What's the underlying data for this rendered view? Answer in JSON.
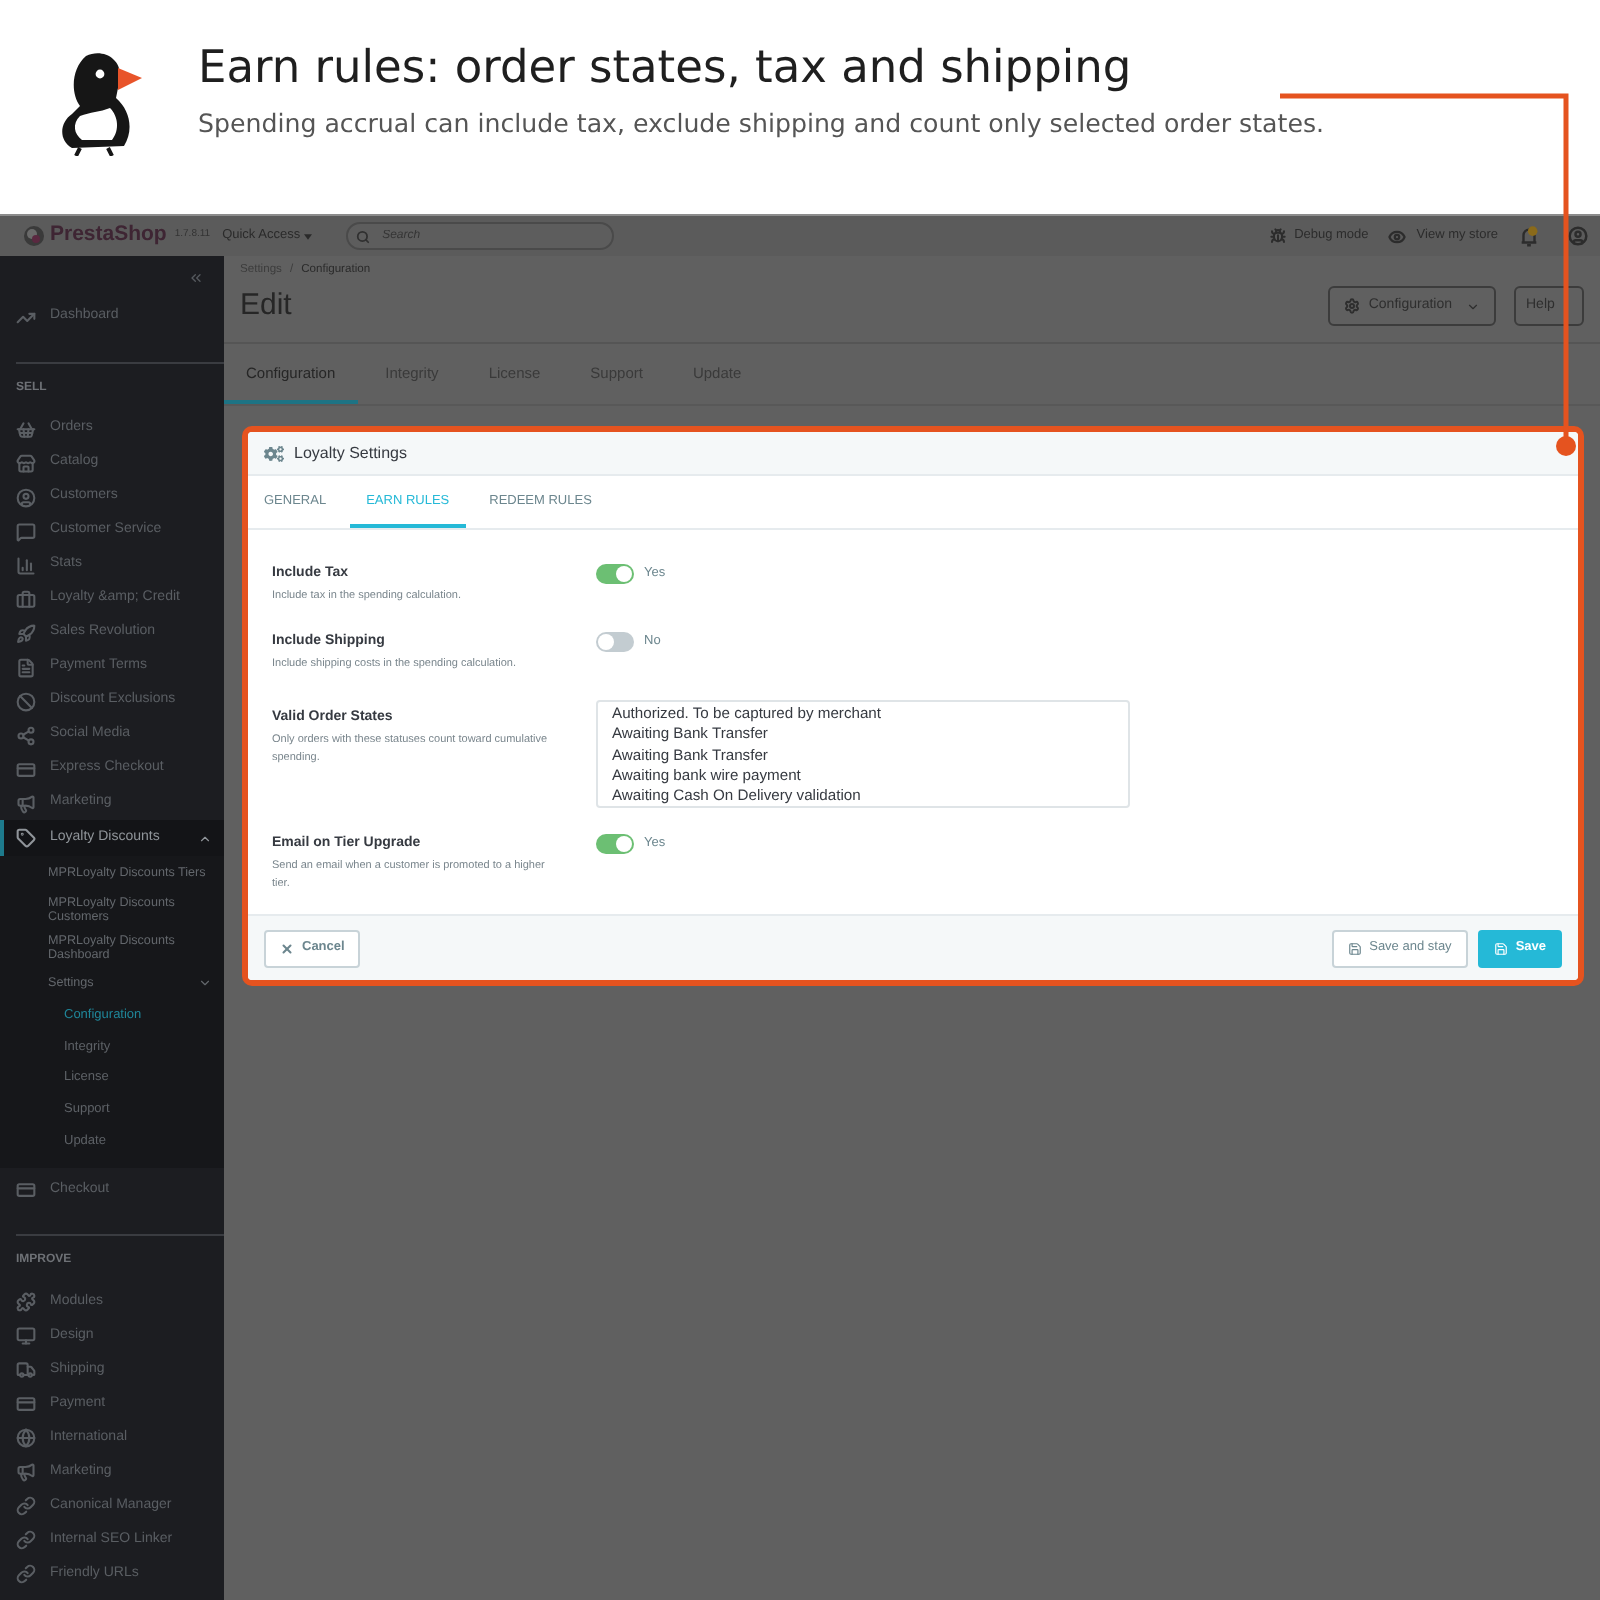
{
  "header": {
    "title": "Earn rules: order states, tax and shipping",
    "subtitle": "Spending accrual can include tax, exclude shipping and count only selected order states."
  },
  "topbar": {
    "brand": "PrestaShop",
    "version": "1.7.8.11",
    "quick_access": "Quick Access",
    "search": {
      "placeholder": "Search"
    },
    "debug_mode": "Debug mode",
    "view_store": "View my store"
  },
  "sidebar": {
    "items": [
      {
        "label": "Dashboard",
        "selected": false
      }
    ],
    "sections": [
      {
        "title": "SELL",
        "items": [
          {
            "label": "Orders",
            "selected": false
          },
          {
            "label": "Catalog",
            "selected": false
          },
          {
            "label": "Customers",
            "selected": false
          },
          {
            "label": "Customer Service",
            "selected": false
          },
          {
            "label": "Stats",
            "selected": false
          },
          {
            "label": "Loyalty &amp; Credit",
            "selected": false
          },
          {
            "label": "Sales Revolution",
            "selected": false
          },
          {
            "label": "Payment Terms",
            "selected": false
          },
          {
            "label": "Discount Exclusions",
            "selected": false
          },
          {
            "label": "Social Media",
            "selected": false
          },
          {
            "label": "Express Checkout",
            "selected": false
          },
          {
            "label": "Marketing",
            "selected": false
          },
          {
            "label": "Loyalty Discounts",
            "selected": true,
            "expanded": true,
            "children": [
              {
                "label": "MPRLoyalty Discounts Tiers",
                "selected": false
              },
              {
                "label": "MPRLoyalty Discounts Customers",
                "selected": false
              },
              {
                "label": "MPRLoyalty Discounts Dashboard",
                "selected": false
              },
              {
                "label": "Settings",
                "selected": false,
                "expanded": true,
                "children": [
                  {
                    "label": "Configuration",
                    "selected": true
                  },
                  {
                    "label": "Integrity",
                    "selected": false
                  },
                  {
                    "label": "License",
                    "selected": false
                  },
                  {
                    "label": "Support",
                    "selected": false
                  },
                  {
                    "label": "Update",
                    "selected": false
                  }
                ]
              }
            ]
          },
          {
            "label": "Checkout",
            "selected": false
          }
        ]
      },
      {
        "title": "IMPROVE",
        "items": [
          {
            "label": "Modules",
            "selected": false
          },
          {
            "label": "Design",
            "selected": false
          },
          {
            "label": "Shipping",
            "selected": false
          },
          {
            "label": "Payment",
            "selected": false
          },
          {
            "label": "International",
            "selected": false
          },
          {
            "label": "Marketing",
            "selected": false
          },
          {
            "label": "Canonical Manager",
            "selected": false
          },
          {
            "label": "Internal SEO Linker",
            "selected": false
          },
          {
            "label": "Friendly URLs",
            "selected": false
          }
        ]
      }
    ]
  },
  "breadcrumb": {
    "parent": "Settings",
    "separator": "/",
    "current": "Configuration"
  },
  "page_title": "Edit",
  "toolbar": {
    "configuration": "Configuration",
    "help": "Help"
  },
  "page_tabs": [
    {
      "label": "Configuration",
      "selected": true
    },
    {
      "label": "Integrity",
      "selected": false
    },
    {
      "label": "License",
      "selected": false
    },
    {
      "label": "Support",
      "selected": false
    },
    {
      "label": "Update",
      "selected": false
    }
  ],
  "panel": {
    "title": "Loyalty Settings",
    "tabs": [
      {
        "label": "GENERAL",
        "selected": false
      },
      {
        "label": "EARN RULES",
        "selected": true
      },
      {
        "label": "REDEEM RULES",
        "selected": false
      }
    ],
    "fields": [
      {
        "kind": "toggle",
        "label": "Include Tax",
        "description": "Include tax in the spending calculation.",
        "on": true,
        "state_label": "Yes"
      },
      {
        "kind": "toggle",
        "label": "Include Shipping",
        "description": "Include shipping costs in the spending calculation.",
        "on": false,
        "state_label": "No"
      },
      {
        "kind": "multiselect",
        "label": "Valid Order States",
        "description": "Only orders with these statuses count toward cumulative spending.",
        "options": [
          {
            "label": "Authorized. To be captured by merchant",
            "selected": false
          },
          {
            "label": "Awaiting Bank Transfer",
            "selected": false
          },
          {
            "label": "Awaiting Bank Transfer",
            "selected": false
          },
          {
            "label": "Awaiting bank wire payment",
            "selected": false
          },
          {
            "label": "Awaiting Cash On Delivery validation",
            "selected": false
          }
        ]
      },
      {
        "kind": "toggle",
        "label": "Email on Tier Upgrade",
        "description": "Send an email when a customer is promoted to a higher tier.",
        "on": true,
        "state_label": "Yes"
      }
    ],
    "footer": {
      "cancel": "Cancel",
      "save_and_stay": "Save and stay",
      "save": "Save"
    }
  }
}
